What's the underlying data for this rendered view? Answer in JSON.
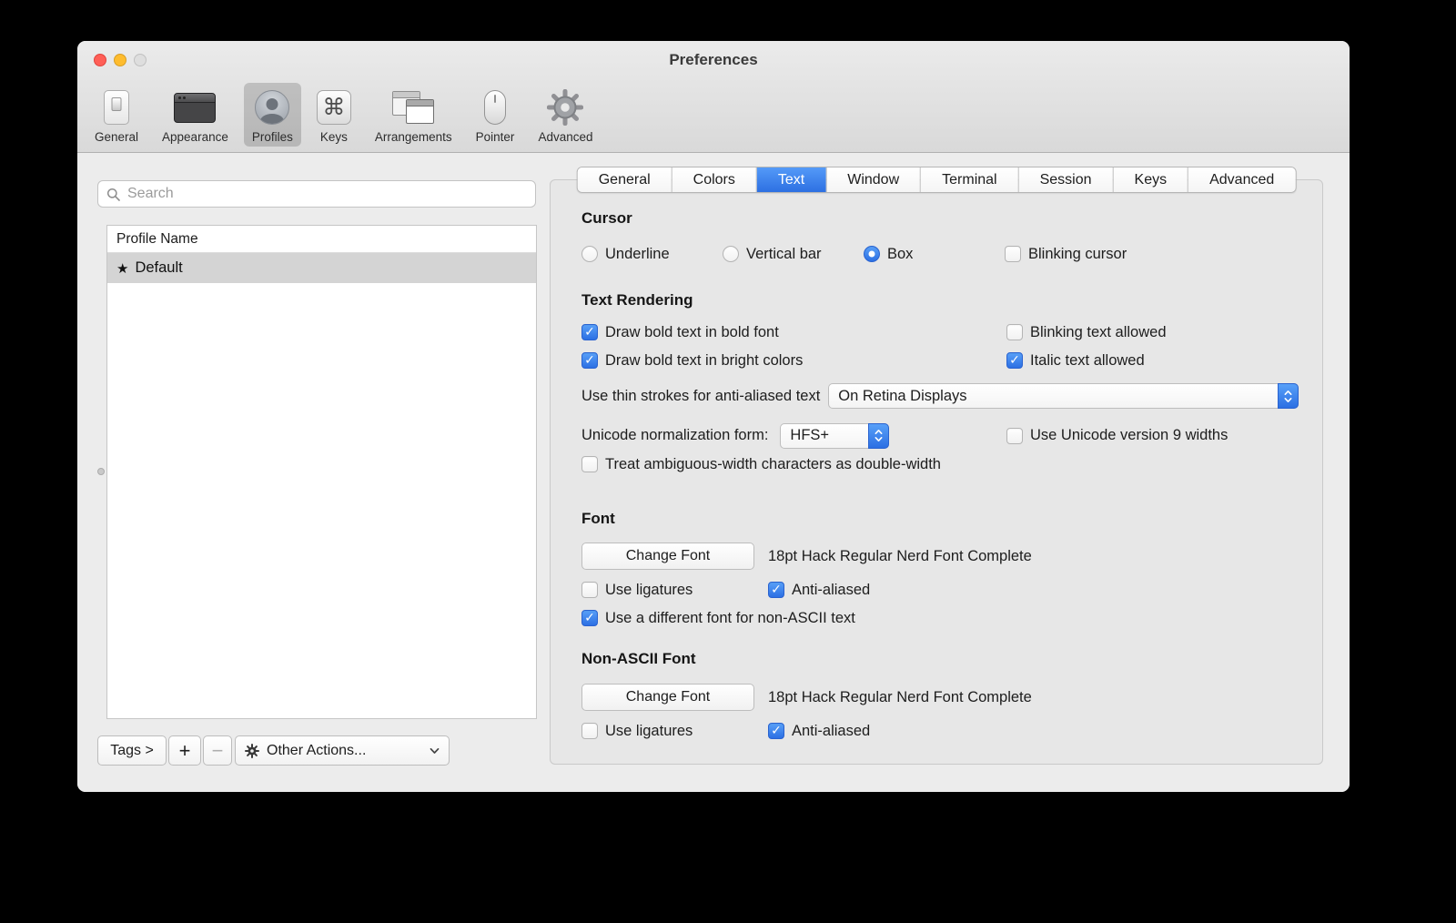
{
  "window": {
    "title": "Preferences"
  },
  "toolbar": {
    "items": [
      {
        "label": "General",
        "icon": "general-icon"
      },
      {
        "label": "Appearance",
        "icon": "appearance-icon"
      },
      {
        "label": "Profiles",
        "icon": "profiles-icon",
        "selected": true
      },
      {
        "label": "Keys",
        "icon": "keys-icon"
      },
      {
        "label": "Arrangements",
        "icon": "arrangements-icon"
      },
      {
        "label": "Pointer",
        "icon": "pointer-icon"
      },
      {
        "label": "Advanced",
        "icon": "advanced-gear-icon"
      }
    ]
  },
  "icons": {
    "command": "⌘",
    "star": "★"
  },
  "sidebar": {
    "search_placeholder": "Search",
    "list_header": "Profile Name",
    "profile": {
      "star": "★",
      "name": "Default",
      "selected": true
    },
    "tags_button": "Tags >",
    "add_button": "+",
    "remove_button": "−",
    "other_actions": "Other Actions..."
  },
  "tabs": {
    "items": [
      {
        "label": "General"
      },
      {
        "label": "Colors"
      },
      {
        "label": "Text"
      },
      {
        "label": "Window"
      },
      {
        "label": "Terminal"
      },
      {
        "label": "Session"
      },
      {
        "label": "Keys"
      },
      {
        "label": "Advanced"
      }
    ],
    "selected": "Text"
  },
  "cursor": {
    "title": "Cursor",
    "underline": "Underline",
    "vertical_bar": "Vertical bar",
    "box": "Box",
    "blinking_cursor": "Blinking cursor"
  },
  "text_rendering": {
    "title": "Text Rendering",
    "draw_bold": "Draw bold text in bold font",
    "blinking_text": "Blinking text allowed",
    "bright_colors": "Draw bold text in bright colors",
    "italic_text": "Italic text allowed",
    "thin_strokes_label": "Use thin strokes for anti-aliased text",
    "thin_strokes_value": "On Retina Displays",
    "unicode_form_label": "Unicode normalization form:",
    "unicode_form_value": "HFS+",
    "unicode_v9": "Use Unicode version 9 widths",
    "ambiguous_width": "Treat ambiguous-width characters as double-width"
  },
  "font": {
    "title": "Font",
    "change_button": "Change Font",
    "description": "18pt Hack Regular Nerd Font Complete",
    "use_ligatures": "Use ligatures",
    "anti_aliased": "Anti-aliased",
    "non_ascii_toggle": "Use a different font for non-ASCII text"
  },
  "non_ascii_font": {
    "title": "Non-ASCII Font",
    "change_button": "Change Font",
    "description": "18pt Hack Regular Nerd Font Complete",
    "use_ligatures": "Use ligatures",
    "anti_aliased": "Anti-aliased"
  },
  "states": {
    "cursor_underline": false,
    "cursor_vertical_bar": false,
    "cursor_box": true,
    "blinking_cursor": false,
    "draw_bold": true,
    "blinking_text": false,
    "bright_colors": true,
    "italic_text": true,
    "unicode_v9": false,
    "ambiguous_width": false,
    "font_use_ligatures": false,
    "font_anti_aliased": true,
    "font_non_ascii": true,
    "nonascii_use_ligatures": false,
    "nonascii_anti_aliased": true
  },
  "colors": {
    "accent_blue": "#3578f0",
    "traffic_red": "#ff5f57",
    "traffic_yellow": "#febc2e",
    "window_bg": "#ececec"
  }
}
